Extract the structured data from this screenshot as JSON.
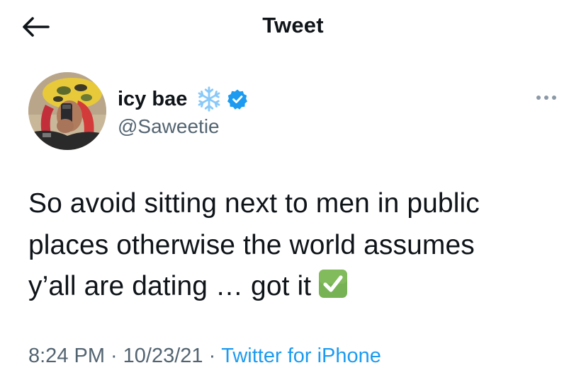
{
  "header": {
    "title": "Tweet",
    "back_icon": "arrow-left-icon"
  },
  "author": {
    "display_name": "icy bae",
    "name_emoji": "snowflake-icon",
    "verified_icon": "verified-badge-icon",
    "handle": "@Saweetie",
    "avatar_icon": "profile-avatar"
  },
  "tweet": {
    "text_line1": "So avoid sitting next to men in public",
    "text_line2": "places otherwise the world assumes",
    "text_line3": "y’all are dating … got it",
    "end_emoji": "check-mark-button-icon"
  },
  "meta": {
    "time": "8:24 PM",
    "date": "10/23/21",
    "separator": "·",
    "source": "Twitter for iPhone"
  },
  "actions": {
    "more_icon": "more-options-icon"
  },
  "colors": {
    "text": "#0f1419",
    "secondary": "#536471",
    "link": "#1d9bf0",
    "verified": "#1d9bf0",
    "check_emoji": "#77b255",
    "snowflake": "#88c9f9"
  }
}
